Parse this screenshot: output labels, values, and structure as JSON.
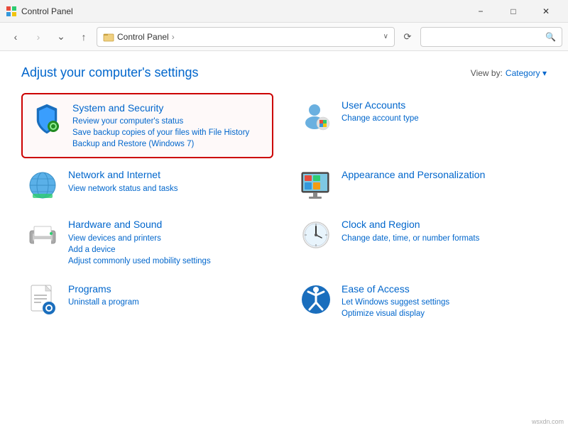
{
  "titleBar": {
    "title": "Control Panel",
    "minimizeLabel": "−",
    "maximizeLabel": "□",
    "closeLabel": "✕"
  },
  "addressBar": {
    "backDisabled": false,
    "forwardDisabled": true,
    "upLabel": "↑",
    "addressIcon": "🖥",
    "pathText": "Control Panel",
    "pathArrow": ">",
    "dropdownArrow": "∨",
    "refreshLabel": "⟳",
    "searchPlaceholder": ""
  },
  "pageHeader": {
    "title": "Adjust your computer's settings",
    "viewByLabel": "View by:",
    "viewByValue": "Category",
    "viewByDropdown": "▾"
  },
  "categories": [
    {
      "id": "system-security",
      "title": "System and Security",
      "highlighted": true,
      "links": [
        "Review your computer's status",
        "Save backup copies of your files with File History",
        "Backup and Restore (Windows 7)"
      ]
    },
    {
      "id": "user-accounts",
      "title": "User Accounts",
      "highlighted": false,
      "links": [
        "Change account type"
      ]
    },
    {
      "id": "network-internet",
      "title": "Network and Internet",
      "highlighted": false,
      "links": [
        "View network status and tasks"
      ]
    },
    {
      "id": "appearance",
      "title": "Appearance and Personalization",
      "highlighted": false,
      "links": []
    },
    {
      "id": "hardware-sound",
      "title": "Hardware and Sound",
      "highlighted": false,
      "links": [
        "View devices and printers",
        "Add a device",
        "Adjust commonly used mobility settings"
      ]
    },
    {
      "id": "clock-region",
      "title": "Clock and Region",
      "highlighted": false,
      "links": [
        "Change date, time, or number formats"
      ]
    },
    {
      "id": "programs",
      "title": "Programs",
      "highlighted": false,
      "links": [
        "Uninstall a program"
      ]
    },
    {
      "id": "ease-access",
      "title": "Ease of Access",
      "highlighted": false,
      "links": [
        "Let Windows suggest settings",
        "Optimize visual display"
      ]
    }
  ],
  "watermark": "wsxdn.com"
}
